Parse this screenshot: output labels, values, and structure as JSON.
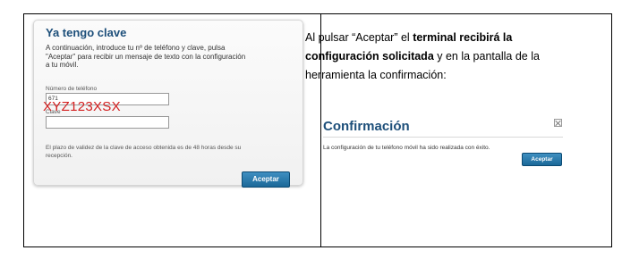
{
  "login": {
    "title": "Ya tengo clave",
    "intro_line1": "A continuación, introduce tu nº de teléfono y clave, pulsa",
    "intro_line2": "\"Aceptar\" para recibir un mensaje de texto con la configuración",
    "intro_line3": "a tu móvil.",
    "phone_label": "Número de teléfono",
    "phone_value": "671",
    "key_label": "Clave",
    "key_value": "XYZ123XSX",
    "validity_line1": "El plazo de validez de la clave de acceso obtenida es de 48 horas desde su",
    "validity_line2": "recepción.",
    "accept_label": "Aceptar"
  },
  "description": {
    "part1": "Al pulsar “Aceptar” el ",
    "bold1": "terminal recibirá la configuración solicitada",
    "part2": " y en la pantalla de la herramienta la confirmación:"
  },
  "confirmation": {
    "title": "Confirmación",
    "message": "La configuración de tu teléfono móvil ha sido realizada con éxito.",
    "accept_label": "Aceptar"
  }
}
